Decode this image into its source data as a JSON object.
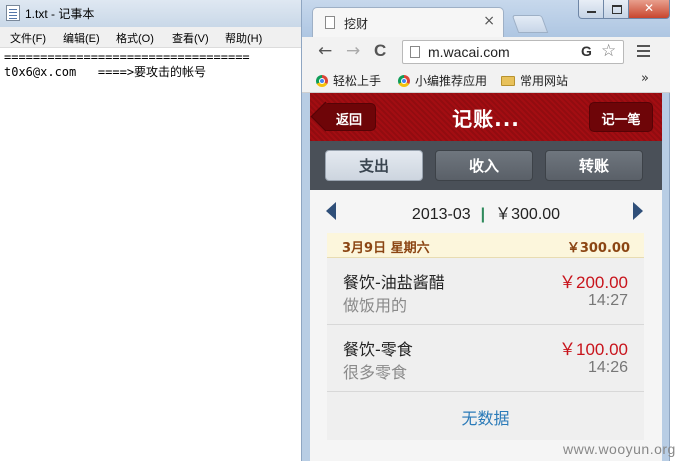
{
  "notepad": {
    "title": "1.txt - 记事本",
    "menu": [
      "文件(F)",
      "编辑(E)",
      "格式(O)",
      "查看(V)",
      "帮助(H)"
    ],
    "content_line1": "==================================",
    "content_line2": "t0x6@x.com   ====>要攻击的帐号"
  },
  "browser": {
    "tab_title": "挖财",
    "tab_close": "×",
    "close_glyph": "✕",
    "back_glyph": "←",
    "forward_glyph": "→",
    "reload_glyph": "C",
    "url": "m.wacai.com",
    "extension_glyph": "G",
    "star_glyph": "☆",
    "bookmarks": [
      "轻松上手",
      "小编推荐应用",
      "常用网站"
    ],
    "bookmarks_more": "»"
  },
  "app": {
    "back_label": "返回",
    "title": "记账...",
    "add_label": "记一笔",
    "tabs": [
      "支出",
      "收入",
      "转账"
    ],
    "active_tab": 0,
    "period": "2013-03",
    "period_sep": "|",
    "period_total": "￥300.00",
    "day": {
      "label": "3月9日 星期六",
      "total": "￥300.00"
    },
    "records": [
      {
        "category": "餐饮-油盐酱醋",
        "note": "做饭用的",
        "amount": "￥200.00",
        "time": "14:27"
      },
      {
        "category": "餐饮-零食",
        "note": "很多零食",
        "amount": "￥100.00",
        "time": "14:26"
      }
    ],
    "no_data": "无数据"
  },
  "watermark": "www.wooyun.org",
  "colors": {
    "header_red": "#a30d12",
    "amount_red": "#c8141c",
    "link_blue": "#2a7ab8",
    "segment_bar": "#4a5058"
  }
}
